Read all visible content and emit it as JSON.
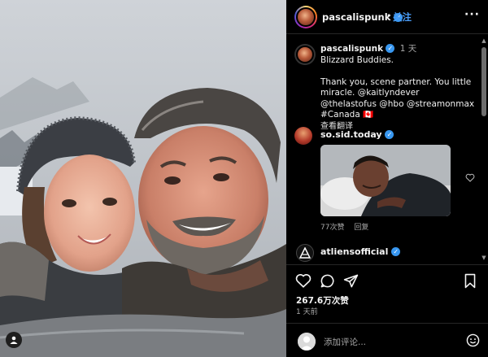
{
  "header": {
    "username": "pascalispunk",
    "separator": "•",
    "follow_label": "关注",
    "more_label": "···"
  },
  "caption": {
    "username": "pascalispunk",
    "time": "1 天",
    "line1": "Blizzard Buddies.",
    "line2": "Thank you, scene partner. You little miracle. @kaitlyndever @thelastofus @hbo @streamonmax #Canada 🇨🇦",
    "translate": "查看翻译"
  },
  "comments": [
    {
      "username": "so.sid.today",
      "likes": "77次赞",
      "reply": "回复"
    },
    {
      "username": "atliensofficial"
    }
  ],
  "footer": {
    "likes": "267.6万次赞",
    "time": "1 天前",
    "add_comment_placeholder": "添加评论..."
  },
  "colors": {
    "accent": "#4a9df8",
    "verified": "#3897f0",
    "background": "#000000"
  },
  "icons": [
    "heart-icon",
    "comment-icon",
    "share-icon",
    "save-icon",
    "emoji-icon",
    "tag-person-icon",
    "more-icon",
    "verified-icon"
  ]
}
